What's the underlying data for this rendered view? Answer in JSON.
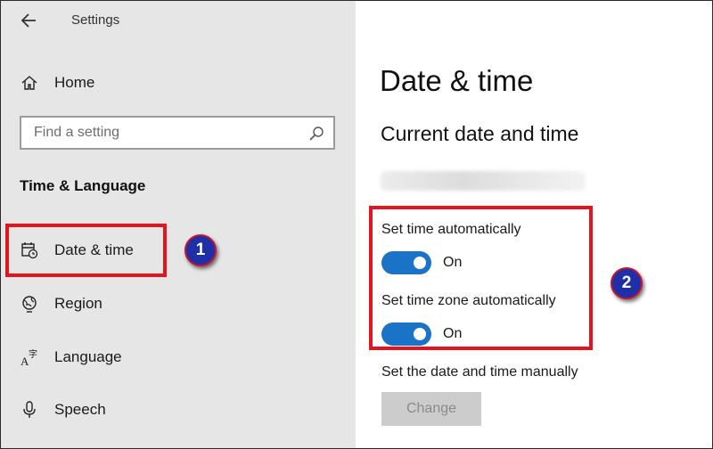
{
  "app": {
    "title": "Settings"
  },
  "sidebar": {
    "home_label": "Home",
    "search_placeholder": "Find a setting",
    "section_title": "Time & Language",
    "items": [
      {
        "label": "Date & time",
        "icon": "calendar-clock-icon",
        "selected": true
      },
      {
        "label": "Region",
        "icon": "globe-icon"
      },
      {
        "label": "Language",
        "icon": "language-icon"
      },
      {
        "label": "Speech",
        "icon": "microphone-icon"
      }
    ]
  },
  "main": {
    "page_title": "Date & time",
    "section_title": "Current date and time",
    "set_time_auto_label": "Set time automatically",
    "set_time_auto_state": "On",
    "set_zone_auto_label": "Set time zone automatically",
    "set_zone_auto_state": "On",
    "manual_label": "Set the date and time manually",
    "change_button": "Change"
  },
  "annotations": {
    "badge_1": "1",
    "badge_2": "2"
  },
  "colors": {
    "accent": "#1a73c7",
    "highlight": "#e2141d",
    "badge": "#1e2fa8",
    "sidebar_bg": "#e6e6e6"
  }
}
